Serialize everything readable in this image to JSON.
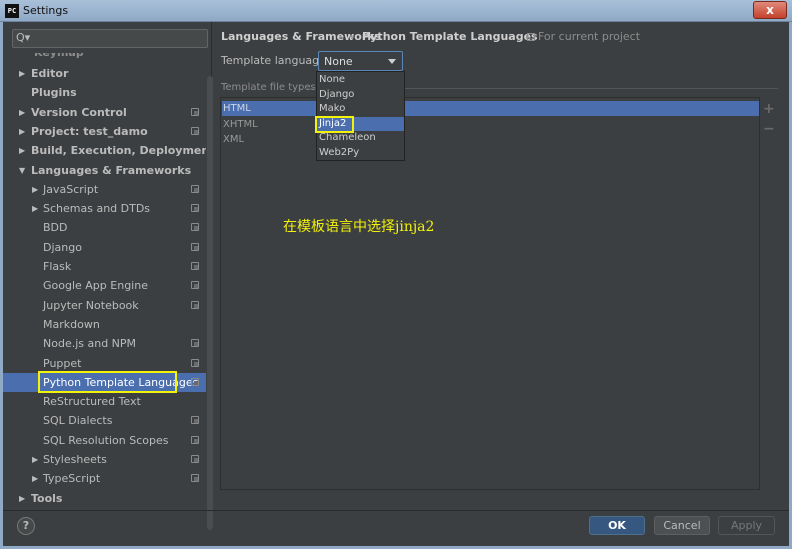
{
  "window": {
    "title": "Settings",
    "app_icon_text": "PC",
    "close_label": "x"
  },
  "search": {
    "placeholder": ""
  },
  "sidebar": {
    "partial_top": "Keymap",
    "items": [
      {
        "label": "Editor",
        "arrow": "▶",
        "bold": true,
        "cfg": false
      },
      {
        "label": "Plugins",
        "arrow": "",
        "bold": true,
        "cfg": false
      },
      {
        "label": "Version Control",
        "arrow": "▶",
        "bold": true,
        "cfg": true
      },
      {
        "label": "Project: test_damo",
        "arrow": "▶",
        "bold": true,
        "cfg": true
      },
      {
        "label": "Build, Execution, Deployment",
        "arrow": "▶",
        "bold": true,
        "cfg": false
      },
      {
        "label": "Languages & Frameworks",
        "arrow": "▼",
        "bold": true,
        "cfg": false
      },
      {
        "label": "JavaScript",
        "arrow": "▶",
        "bold": false,
        "cfg": true
      },
      {
        "label": "Schemas and DTDs",
        "arrow": "▶",
        "bold": false,
        "cfg": true
      },
      {
        "label": "BDD",
        "arrow": "",
        "bold": false,
        "cfg": true
      },
      {
        "label": "Django",
        "arrow": "",
        "bold": false,
        "cfg": true
      },
      {
        "label": "Flask",
        "arrow": "",
        "bold": false,
        "cfg": true
      },
      {
        "label": "Google App Engine",
        "arrow": "",
        "bold": false,
        "cfg": true
      },
      {
        "label": "Jupyter Notebook",
        "arrow": "",
        "bold": false,
        "cfg": true
      },
      {
        "label": "Markdown",
        "arrow": "",
        "bold": false,
        "cfg": false
      },
      {
        "label": "Node.js and NPM",
        "arrow": "",
        "bold": false,
        "cfg": true
      },
      {
        "label": "Puppet",
        "arrow": "",
        "bold": false,
        "cfg": true
      },
      {
        "label": "Python Template Languages",
        "arrow": "",
        "bold": false,
        "cfg": true,
        "selected": true
      },
      {
        "label": "ReStructured Text",
        "arrow": "",
        "bold": false,
        "cfg": false
      },
      {
        "label": "SQL Dialects",
        "arrow": "",
        "bold": false,
        "cfg": true
      },
      {
        "label": "SQL Resolution Scopes",
        "arrow": "",
        "bold": false,
        "cfg": true
      },
      {
        "label": "Stylesheets",
        "arrow": "▶",
        "bold": false,
        "cfg": true
      },
      {
        "label": "TypeScript",
        "arrow": "▶",
        "bold": false,
        "cfg": true
      },
      {
        "label": "Tools",
        "arrow": "▶",
        "bold": true,
        "cfg": false
      }
    ]
  },
  "breadcrumb": {
    "parent": "Languages & Frameworks",
    "separator": "›",
    "current": "Python Template Languages"
  },
  "for_current_project": "For current project",
  "template_language": {
    "label": "Template language:",
    "value": "None",
    "options": [
      "None",
      "Django",
      "Mako",
      "Jinja2",
      "Chameleon",
      "Web2Py"
    ],
    "highlighted": "Jinja2"
  },
  "file_types": {
    "label": "Template file types",
    "items": [
      "HTML",
      "XHTML",
      "XML"
    ],
    "selected": "HTML"
  },
  "side_tools": {
    "add": "+",
    "remove": "−"
  },
  "annotation": "在模板语言中选择jinja2",
  "footer": {
    "help": "?",
    "ok": "OK",
    "cancel": "Cancel",
    "apply": "Apply"
  },
  "colors": {
    "selection": "#4b6eaf",
    "highlight_box": "#f2f20a",
    "panel_bg": "#3c3f41"
  }
}
